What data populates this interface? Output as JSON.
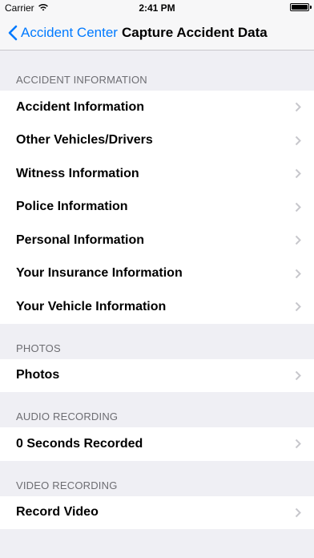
{
  "status_bar": {
    "carrier": "Carrier",
    "time": "2:41 PM"
  },
  "nav": {
    "back_label": "Accident Center",
    "title": "Capture Accident Data"
  },
  "sections": [
    {
      "header": "ACCIDENT INFORMATION",
      "items": [
        "Accident Information",
        "Other Vehicles/Drivers",
        "Witness Information",
        "Police Information",
        "Personal Information",
        "Your Insurance Information",
        "Your Vehicle Information"
      ]
    },
    {
      "header": "PHOTOS",
      "items": [
        "Photos"
      ]
    },
    {
      "header": "AUDIO RECORDING",
      "items": [
        "0 Seconds Recorded"
      ]
    },
    {
      "header": "VIDEO RECORDING",
      "items": [
        "Record Video"
      ]
    }
  ],
  "colors": {
    "tint": "#007aff",
    "background": "#efeff4",
    "header_text": "#6d6d72",
    "chevron": "#c7c7cc"
  },
  "icons": {
    "back": "chevron-left-icon",
    "disclosure": "chevron-right-icon",
    "wifi": "wifi-icon",
    "battery": "battery-icon"
  }
}
